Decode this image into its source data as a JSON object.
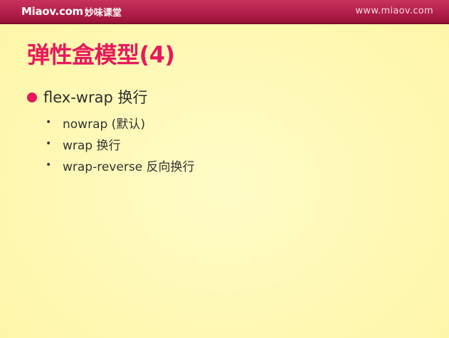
{
  "header": {
    "logo_text": "Miaov.com",
    "logo_subtitle": "妙味课堂",
    "site_url": "www.miaov.com"
  },
  "slide": {
    "title": "弹性盒模型(4)",
    "main_point": "flex-wrap 换行",
    "sub_points": [
      "nowrap (默认)",
      "wrap 换行",
      "wrap-reverse 反向换行"
    ]
  },
  "colors": {
    "background": "#fff9b8",
    "header_bar": "#b21f4a",
    "title": "#e8185c",
    "bullet": "#e8185c",
    "body_text": "#333333"
  },
  "icons": {
    "main_bullet": "filled-circle",
    "sub_bullet": "small-dot"
  }
}
